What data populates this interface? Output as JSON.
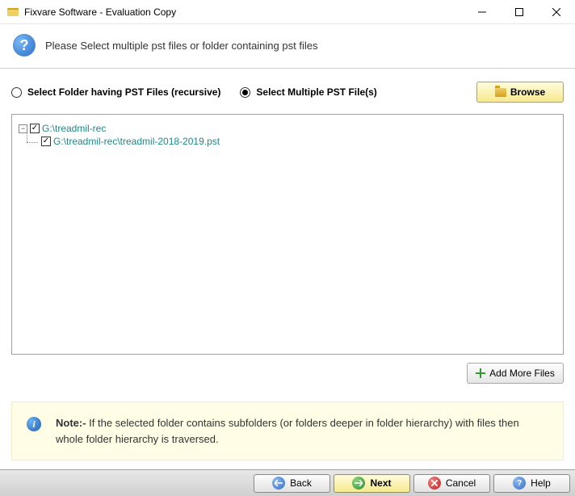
{
  "window": {
    "title": "Fixvare Software - Evaluation Copy"
  },
  "header": {
    "instruction": "Please Select multiple pst files or folder containing pst files"
  },
  "options": {
    "folder_recursive": "Select Folder having PST Files (recursive)",
    "multiple_files": "Select Multiple PST File(s)",
    "browse_label": "Browse"
  },
  "tree": {
    "root": "G:\\treadmil-rec",
    "child": "G:\\treadmil-rec\\treadmil-2018-2019.pst"
  },
  "add_more_label": "Add More Files",
  "note": {
    "prefix": "Note:-",
    "body": " If the selected folder contains subfolders (or folders deeper in folder hierarchy) with files then whole folder hierarchy is traversed."
  },
  "footer": {
    "back": "Back",
    "next": "Next",
    "cancel": "Cancel",
    "help": "Help"
  }
}
